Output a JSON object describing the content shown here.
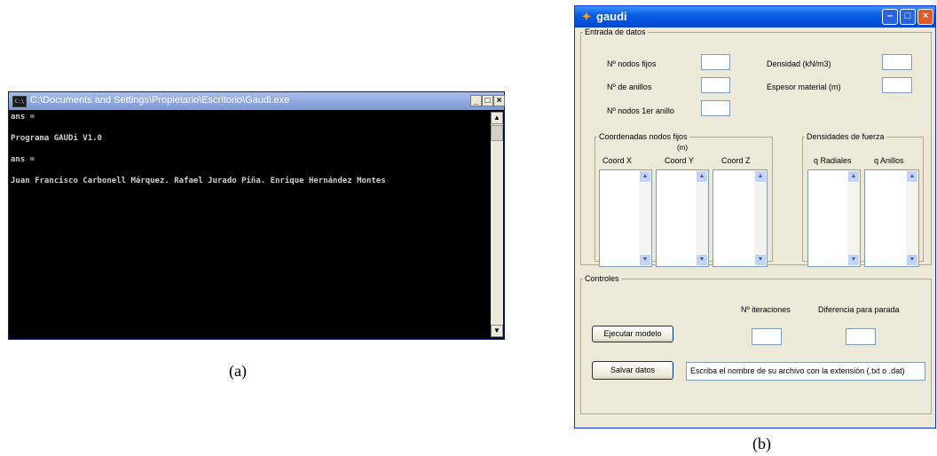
{
  "console": {
    "title": "C:\\Documents and Settings\\Propietario\\Escritorio\\Gaudi.exe",
    "system_icon_text": "C:\\",
    "controls": {
      "minimize": "_",
      "maximize": "□",
      "close": "×"
    },
    "lines": [
      "ans =",
      "",
      "Programa GAUDi V1.0",
      "",
      "ans =",
      "",
      "Juan Francisco Carbonell Márquez. Rafael Jurado Piña. Enrique Hernández Montes"
    ]
  },
  "captions": {
    "a": "(a)",
    "b": "(b)"
  },
  "gaudi": {
    "title": "gaudi",
    "entrada": {
      "legend": "Entrada de datos",
      "n_nodos_fijos_label": "Nº nodos fijos",
      "n_anillos_label": "Nº de anillos",
      "n_nodos_1er_anillo_label": "Nº nodos 1er anillo",
      "densidad_label": "Densidad (kN/m3)",
      "espesor_label": "Espesor material (m)",
      "n_nodos_fijos_value": "",
      "n_anillos_value": "",
      "n_nodos_1er_anillo_value": "",
      "densidad_value": "",
      "espesor_value": ""
    },
    "coordenadas": {
      "legend": "Coordenadas nodos fijos",
      "unit": "(m)",
      "columns": [
        "Coord X",
        "Coord Y",
        "Coord Z"
      ]
    },
    "densidades": {
      "legend": "Densidades de fuerza",
      "columns": [
        "q Radiales",
        "q Anillos"
      ]
    },
    "controles": {
      "legend": "Controles",
      "iteraciones_label": "Nº iteraciones",
      "diferencia_label": "Diferencia para parada",
      "iteraciones_value": "",
      "diferencia_value": "",
      "ejecutar_button": "Ejecutar modelo",
      "salvar_button": "Salvar datos",
      "filename_placeholder": "Escriba el nombre de su archivo con la extensión (.txt o .dat)"
    }
  }
}
